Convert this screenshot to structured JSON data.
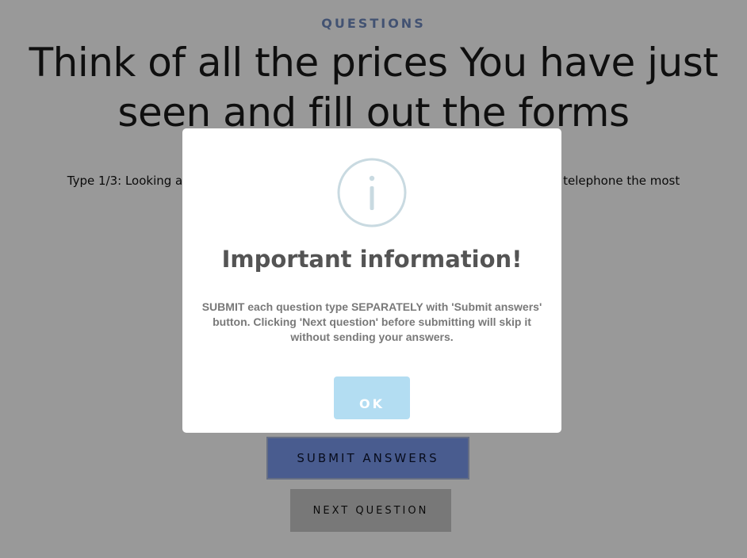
{
  "header": {
    "section_label": "QUESTIONS",
    "title": "Think of all the prices You have just seen and fill out the forms"
  },
  "question": {
    "text_left": "Type 1/3: Looking at",
    "text_right": "telephone the most"
  },
  "buttons": {
    "submit_label": "SUBMIT ANSWERS",
    "next_label": "NEXT QUESTION"
  },
  "modal": {
    "icon": "info-icon",
    "title": "Important information!",
    "message": "SUBMIT each question type SEPARATELY with 'Submit answers' button. Clicking 'Next question' before submitting will skip it without sending your answers.",
    "ok_label": "OK"
  },
  "colors": {
    "accent": "#6f89bf",
    "submit_button": "#7b9aef",
    "ok_button": "#b3ddf2",
    "overlay": "rgba(0,0,0,0.4)"
  }
}
